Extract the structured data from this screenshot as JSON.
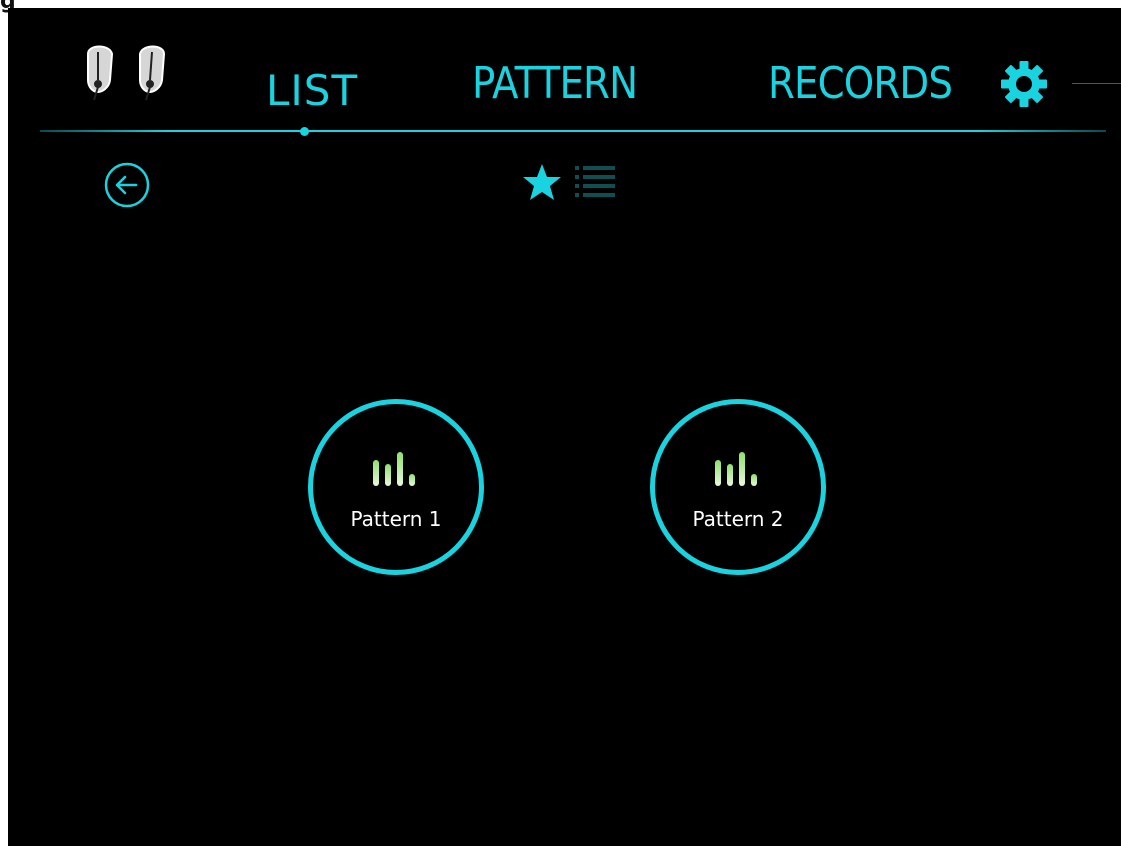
{
  "corner_text": "g",
  "nav": {
    "tabs": [
      {
        "label": "LIST",
        "active": true
      },
      {
        "label": "PATTERN",
        "active": false
      },
      {
        "label": "RECORDS",
        "active": false
      }
    ]
  },
  "patterns": [
    {
      "label": "Pattern 1"
    },
    {
      "label": "Pattern 2"
    }
  ],
  "icons": {
    "device": "earbuds-icon",
    "settings": "gear-icon",
    "back": "back-arrow-icon",
    "favorites": "star-icon",
    "list_view": "list-icon",
    "pattern": "signal-bars-icon"
  },
  "colors": {
    "accent": "#19d3e0",
    "background": "#000000",
    "bars_light": "#e9f7dc",
    "bars_green": "#8ee06a",
    "callout": "#e01818"
  }
}
